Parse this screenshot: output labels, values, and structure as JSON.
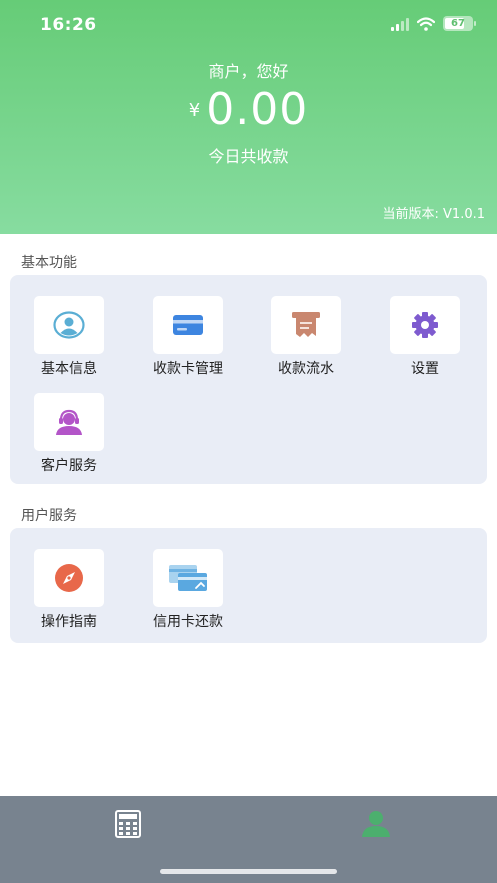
{
  "status": {
    "time": "16:26",
    "battery": "67"
  },
  "header": {
    "greeting": "商户，您好",
    "currency": "¥",
    "amount": "0.00",
    "subtitle": "今日共收款",
    "version": "当前版本: V1.0.1"
  },
  "sections": {
    "basic": {
      "title": "基本功能",
      "items": [
        {
          "label": "基本信息",
          "icon": "user-info-icon"
        },
        {
          "label": "收款卡管理",
          "icon": "bank-card-icon"
        },
        {
          "label": "收款流水",
          "icon": "receipt-icon"
        },
        {
          "label": "设置",
          "icon": "gear-icon"
        },
        {
          "label": "客户服务",
          "icon": "customer-service-icon"
        }
      ]
    },
    "user": {
      "title": "用户服务",
      "items": [
        {
          "label": "操作指南",
          "icon": "compass-icon"
        },
        {
          "label": "信用卡还款",
          "icon": "credit-card-repay-icon"
        }
      ]
    }
  },
  "tabbar": {
    "tabs": [
      {
        "icon": "calculator-icon",
        "active": false
      },
      {
        "icon": "person-icon",
        "active": true
      }
    ]
  },
  "colors": {
    "header_top": "#66cc77",
    "header_bottom": "#87dca0",
    "card_bg": "#e9edf6",
    "tabbar_bg": "#78838f",
    "active_tab": "#4caf6e"
  }
}
